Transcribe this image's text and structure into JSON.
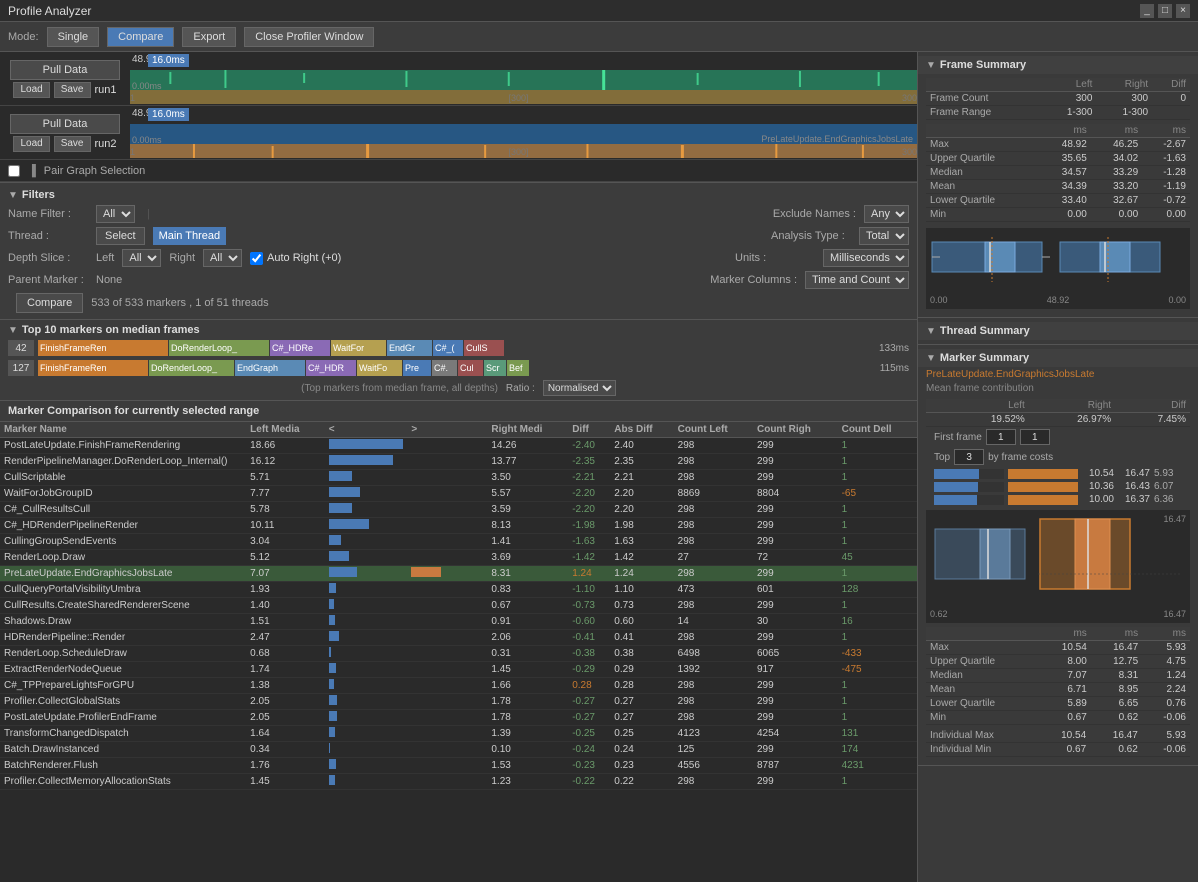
{
  "titleBar": {
    "title": "Profile Analyzer",
    "controls": [
      "_",
      "□",
      "×"
    ]
  },
  "toolbar": {
    "modeLabel": "Mode:",
    "singleBtn": "Single",
    "compareBtn": "Compare",
    "exportBtn": "Export",
    "closeBtn": "Close Profiler Window"
  },
  "graphs": [
    {
      "pullDataLabel": "Pull Data",
      "loadLabel": "Load",
      "saveLabel": "Save",
      "runLabel": "run1",
      "msValue": "48.9ms ▼",
      "msBottom": "0.00ms",
      "timelineMarker": "16.0ms",
      "start": "1",
      "mid": "[300]",
      "end": "300"
    },
    {
      "pullDataLabel": "Pull Data",
      "loadLabel": "Load",
      "saveLabel": "Save",
      "runLabel": "run2",
      "msValue": "48.9ms ▼",
      "msBottom": "0.00ms",
      "timelineMarker": "16.0ms",
      "start": "1",
      "mid": "[300]",
      "end": "300",
      "prelateLabel": "PreLateUpdate.EndGraphicsJobsLate"
    }
  ],
  "pairGraph": {
    "checkboxLabel": "Pair Graph Selection"
  },
  "filters": {
    "sectionTitle": "Filters",
    "nameFilter": {
      "label": "Name Filter :",
      "value": "All"
    },
    "excludeNames": {
      "label": "Exclude Names :",
      "value": "Any"
    },
    "thread": {
      "label": "Thread :",
      "selectBtn": "Select",
      "threadName": "Main Thread"
    },
    "depthSlice": {
      "label": "Depth Slice :",
      "leftLabel": "Left",
      "leftValue": "All",
      "rightLabel": "Right",
      "rightValue": "All",
      "autoRight": "Auto Right (+0)"
    },
    "analysisType": {
      "label": "Analysis Type :",
      "value": "Total"
    },
    "units": {
      "label": "Units :",
      "value": "Milliseconds"
    },
    "parentMarker": {
      "label": "Parent Marker :",
      "value": "None"
    },
    "markerColumns": {
      "label": "Marker Columns :",
      "value": "Time and Count"
    },
    "compareBtn": "Compare",
    "info": "533 of 533 markers ,  1 of 51 threads"
  },
  "top10": {
    "sectionTitle": "Top 10 markers on median frames",
    "rows": [
      {
        "num": "42",
        "ms": "133ms",
        "bars": [
          "FinishFrameRen",
          "DoRenderLoop_",
          "C#_HDRe",
          "WaitFor",
          "EndGr",
          "C#_(",
          "CullS"
        ]
      },
      {
        "num": "127",
        "ms": "115ms",
        "bars": [
          "FinishFrameRen",
          "DoRenderLoop_",
          "EndGraph",
          "C#_HDR",
          "WaitFo",
          "Pre",
          "C#.",
          "Cul",
          "Scr",
          "Bef"
        ]
      }
    ],
    "info": "(Top markers from median frame, all depths)",
    "ratioLabel": "Ratio :",
    "ratioValue": "Normalised"
  },
  "markerComparison": {
    "sectionTitle": "Marker Comparison for currently selected range",
    "columns": [
      "Marker Name",
      "Left Media",
      "<",
      ">",
      "Right Medi",
      "Diff",
      "Abs Diff",
      "Count Left",
      "Count Righ",
      "Count Dell"
    ],
    "rows": [
      {
        "name": "PostLateUpdate.FinishFrameRendering",
        "leftMedia": "18.66",
        "diff": "-2.40",
        "absDiff": "2.40",
        "rightMedi": "14.26",
        "countLeft": "298",
        "countRight": "299",
        "countDell": "1"
      },
      {
        "name": "RenderPipelineManager.DoRenderLoop_Internal()",
        "leftMedia": "16.12",
        "diff": "-2.35",
        "absDiff": "2.35",
        "rightMedi": "13.77",
        "countLeft": "298",
        "countRight": "299",
        "countDell": "1"
      },
      {
        "name": "CullScriptable",
        "leftMedia": "5.71",
        "diff": "-2.21",
        "absDiff": "2.21",
        "rightMedi": "3.50",
        "countLeft": "298",
        "countRight": "299",
        "countDell": "1"
      },
      {
        "name": "WaitForJobGroupID",
        "leftMedia": "7.77",
        "diff": "-2.20",
        "absDiff": "2.20",
        "rightMedi": "5.57",
        "countLeft": "8869",
        "countRight": "8804",
        "countDell": "-65"
      },
      {
        "name": "C#_CullResultsCull",
        "leftMedia": "5.78",
        "diff": "-2.20",
        "absDiff": "2.20",
        "rightMedi": "3.59",
        "countLeft": "298",
        "countRight": "299",
        "countDell": "1"
      },
      {
        "name": "C#_HDRenderPipelineRender",
        "leftMedia": "10.11",
        "diff": "-1.98",
        "absDiff": "1.98",
        "rightMedi": "8.13",
        "countLeft": "298",
        "countRight": "299",
        "countDell": "1"
      },
      {
        "name": "CullingGroupSendEvents",
        "leftMedia": "3.04",
        "diff": "-1.63",
        "absDiff": "1.63",
        "rightMedi": "1.41",
        "countLeft": "298",
        "countRight": "299",
        "countDell": "1"
      },
      {
        "name": "RenderLoop.Draw",
        "leftMedia": "5.12",
        "diff": "-1.42",
        "absDiff": "1.42",
        "rightMedi": "3.69",
        "countLeft": "27",
        "countRight": "72",
        "countDell": "45"
      },
      {
        "name": "PreLateUpdate.EndGraphicsJobsLate",
        "leftMedia": "7.07",
        "diff": "1.24",
        "absDiff": "1.24",
        "rightMedi": "8.31",
        "countLeft": "298",
        "countRight": "299",
        "countDell": "1",
        "highlighted": true
      },
      {
        "name": "CullQueryPortalVisibilityUmbra",
        "leftMedia": "1.93",
        "diff": "-1.10",
        "absDiff": "1.10",
        "rightMedi": "0.83",
        "countLeft": "473",
        "countRight": "601",
        "countDell": "128"
      },
      {
        "name": "CullResults.CreateSharedRendererScene",
        "leftMedia": "1.40",
        "diff": "-0.73",
        "absDiff": "0.73",
        "rightMedi": "0.67",
        "countLeft": "298",
        "countRight": "299",
        "countDell": "1"
      },
      {
        "name": "Shadows.Draw",
        "leftMedia": "1.51",
        "diff": "-0.60",
        "absDiff": "0.60",
        "rightMedi": "0.91",
        "countLeft": "14",
        "countRight": "30",
        "countDell": "16"
      },
      {
        "name": "HDRenderPipeline::Render",
        "leftMedia": "2.47",
        "diff": "-0.41",
        "absDiff": "0.41",
        "rightMedi": "2.06",
        "countLeft": "298",
        "countRight": "299",
        "countDell": "1"
      },
      {
        "name": "RenderLoop.ScheduleDraw",
        "leftMedia": "0.68",
        "diff": "-0.38",
        "absDiff": "0.38",
        "rightMedi": "0.31",
        "countLeft": "6498",
        "countRight": "6065",
        "countDell": "-433"
      },
      {
        "name": "ExtractRenderNodeQueue",
        "leftMedia": "1.74",
        "diff": "-0.29",
        "absDiff": "0.29",
        "rightMedi": "1.45",
        "countLeft": "1392",
        "countRight": "917",
        "countDell": "-475"
      },
      {
        "name": "C#_TPPrepareLightsForGPU",
        "leftMedia": "1.38",
        "diff": "0.28",
        "absDiff": "0.28",
        "rightMedi": "1.66",
        "countLeft": "298",
        "countRight": "299",
        "countDell": "1"
      },
      {
        "name": "Profiler.CollectGlobalStats",
        "leftMedia": "2.05",
        "diff": "-0.27",
        "absDiff": "0.27",
        "rightMedi": "1.78",
        "countLeft": "298",
        "countRight": "299",
        "countDell": "1"
      },
      {
        "name": "PostLateUpdate.ProfilerEndFrame",
        "leftMedia": "2.05",
        "diff": "-0.27",
        "absDiff": "0.27",
        "rightMedi": "1.78",
        "countLeft": "298",
        "countRight": "299",
        "countDell": "1"
      },
      {
        "name": "TransformChangedDispatch",
        "leftMedia": "1.64",
        "diff": "-0.25",
        "absDiff": "0.25",
        "rightMedi": "1.39",
        "countLeft": "4123",
        "countRight": "4254",
        "countDell": "131"
      },
      {
        "name": "Batch.DrawInstanced",
        "leftMedia": "0.34",
        "diff": "-0.24",
        "absDiff": "0.24",
        "rightMedi": "0.10",
        "countLeft": "125",
        "countRight": "299",
        "countDell": "174"
      },
      {
        "name": "BatchRenderer.Flush",
        "leftMedia": "1.76",
        "diff": "-0.23",
        "absDiff": "0.23",
        "rightMedi": "1.53",
        "countLeft": "4556",
        "countRight": "8787",
        "countDell": "4231"
      },
      {
        "name": "Profiler.CollectMemoryAllocationStats",
        "leftMedia": "1.45",
        "diff": "-0.22",
        "absDiff": "0.22",
        "rightMedi": "1.23",
        "countLeft": "298",
        "countRight": "299",
        "countDell": "1"
      }
    ]
  },
  "rightPanel": {
    "frameSummary": {
      "title": "Frame Summary",
      "columns": [
        "",
        "Left",
        "Right",
        "Diff"
      ],
      "rows": [
        {
          "label": "Frame Count",
          "left": "300",
          "right": "300",
          "diff": "0"
        },
        {
          "label": "Frame Range",
          "left": "1-300",
          "right": "1-300",
          "diff": ""
        }
      ],
      "statsColumns": [
        "ms",
        "ms",
        "ms"
      ],
      "stats": [
        {
          "label": "Max",
          "left": "48.92",
          "right": "46.25",
          "diff": "-2.67"
        },
        {
          "label": "Upper Quartile",
          "left": "35.65",
          "right": "34.02",
          "diff": "-1.63"
        },
        {
          "label": "Median",
          "left": "34.57",
          "right": "33.29",
          "diff": "-1.28"
        },
        {
          "label": "Mean",
          "left": "34.39",
          "right": "33.20",
          "diff": "-1.19"
        },
        {
          "label": "Lower Quartile",
          "left": "33.40",
          "right": "32.67",
          "diff": "-0.72"
        },
        {
          "label": "Min",
          "left": "0.00",
          "right": "0.00",
          "diff": "0.00"
        }
      ],
      "boxMin": "0.00",
      "boxMax": "48.92",
      "boxVal": "48.92",
      "boxBottom": "0.00"
    },
    "threadSummary": {
      "title": "Thread Summary"
    },
    "markerSummary": {
      "title": "Marker Summary",
      "markerName": "PreLateUpdate.EndGraphicsJobsLate",
      "subLabel": "Mean frame contribution",
      "columns": [
        "",
        "Left",
        "Right",
        "Diff"
      ],
      "leftPct": "19.52%",
      "rightPct": "26.97%",
      "diffPct": "7.45%",
      "firstFrameLabel": "First frame",
      "firstFrameLeft": "1",
      "firstFrameRight": "1",
      "topLabel": "Top",
      "topVal": "3",
      "byFrameLabel": "by frame costs",
      "costBars": [
        {
          "left": "10.54",
          "right": "16.47",
          "diff": "5.93",
          "leftW": 64,
          "rightW": 100
        },
        {
          "left": "10.36",
          "right": "16.43",
          "diff": "6.07",
          "leftW": 63,
          "rightW": 100
        },
        {
          "left": "10.00",
          "right": "16.37",
          "diff": "6.36",
          "leftW": 61,
          "rightW": 100
        }
      ],
      "boxMax": "16.47",
      "boxMin": "0.62",
      "boxLeft": "0.62",
      "boxRight": "16.47",
      "stats": [
        {
          "label": "Max",
          "left": "10.54",
          "right": "16.47",
          "diff": "5.93"
        },
        {
          "label": "Upper Quartile",
          "left": "8.00",
          "right": "12.75",
          "diff": "4.75"
        },
        {
          "label": "Median",
          "left": "7.07",
          "right": "8.31",
          "diff": "1.24"
        },
        {
          "label": "Mean",
          "left": "6.71",
          "right": "8.95",
          "diff": "2.24"
        },
        {
          "label": "Lower Quartile",
          "left": "5.89",
          "right": "6.65",
          "diff": "0.76"
        },
        {
          "label": "Min",
          "left": "0.67",
          "right": "0.62",
          "diff": "-0.06"
        }
      ],
      "statsColumns": [
        "ms",
        "ms",
        "ms"
      ],
      "indivMax": {
        "label": "Individual Max",
        "left": "10.54",
        "right": "16.47",
        "diff": "5.93"
      },
      "indivMin": {
        "label": "Individual Min",
        "left": "0.67",
        "right": "0.62",
        "diff": "-0.06"
      }
    }
  }
}
